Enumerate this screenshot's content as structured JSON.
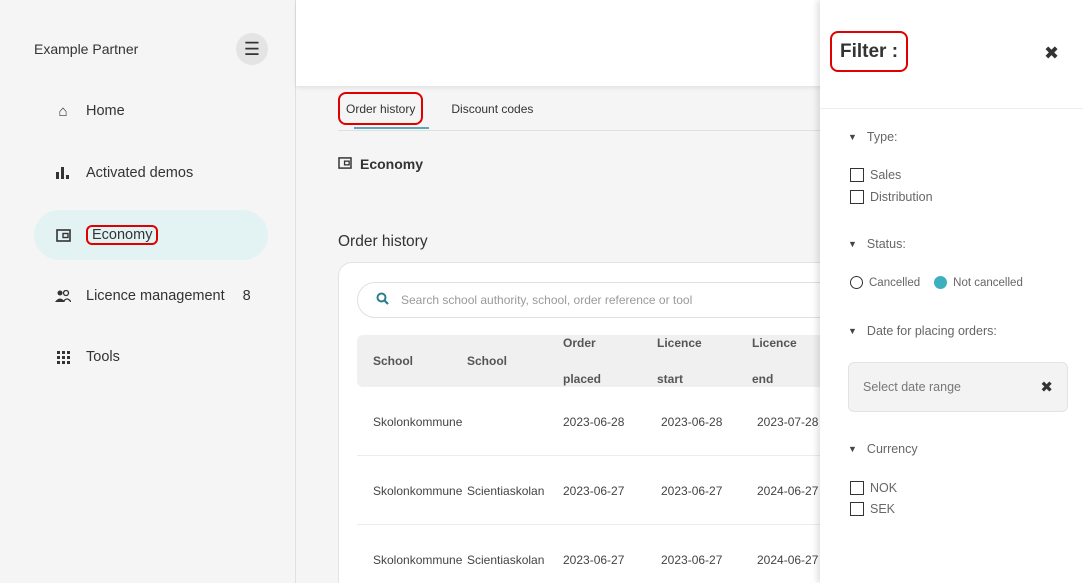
{
  "sidebar": {
    "partner_name": "Example Partner",
    "menu_icon": "☰",
    "items": [
      {
        "label": "Home",
        "icon": "⌂",
        "icon_name": "home-icon",
        "badge": ""
      },
      {
        "label": "Activated demos",
        "icon": "▮",
        "icon_name": "bar-chart-icon",
        "badge": ""
      },
      {
        "label": "Economy",
        "icon": "▣",
        "icon_name": "wallet-icon",
        "badge": ""
      },
      {
        "label": "Licence management",
        "icon": "👥",
        "icon_name": "people-icon",
        "badge": "8"
      },
      {
        "label": "Tools",
        "icon": "⠿",
        "icon_name": "grid-icon",
        "badge": ""
      }
    ],
    "active_color": "#e3f3f4"
  },
  "main": {
    "tabs": [
      {
        "label": "Order history"
      },
      {
        "label": "Discount codes"
      }
    ],
    "section_title": "Economy",
    "order_heading": "Order history",
    "search_placeholder": "Search school authority, school, order reference or tool",
    "columns": [
      "School",
      "School",
      "Order placed",
      "Licence start",
      "Licence end"
    ],
    "rows": [
      [
        "Skolonkommune",
        "",
        "2023-06-28",
        "2023-06-28",
        "2023-07-28"
      ],
      [
        "Skolonkommune",
        "Scientiaskolan",
        "2023-06-27",
        "2023-06-27",
        "2024-06-27"
      ],
      [
        "Skolonkommune",
        "Scientiaskolan",
        "2023-06-27",
        "2023-06-27",
        "2024-06-27"
      ]
    ],
    "accent_color": "#5ea7b8"
  },
  "filter": {
    "title": "Filter :",
    "close_icon": "✖",
    "type_label": "Type:",
    "type_options": [
      "Sales",
      "Distribution"
    ],
    "status_label": "Status:",
    "status_options": [
      "Cancelled",
      "Not cancelled"
    ],
    "date_label": "Date for placing orders:",
    "date_placeholder": "Select date range",
    "currency_label": "Currency",
    "currency_options": [
      "NOK",
      "SEK"
    ],
    "highlight_color": "#e00000"
  }
}
